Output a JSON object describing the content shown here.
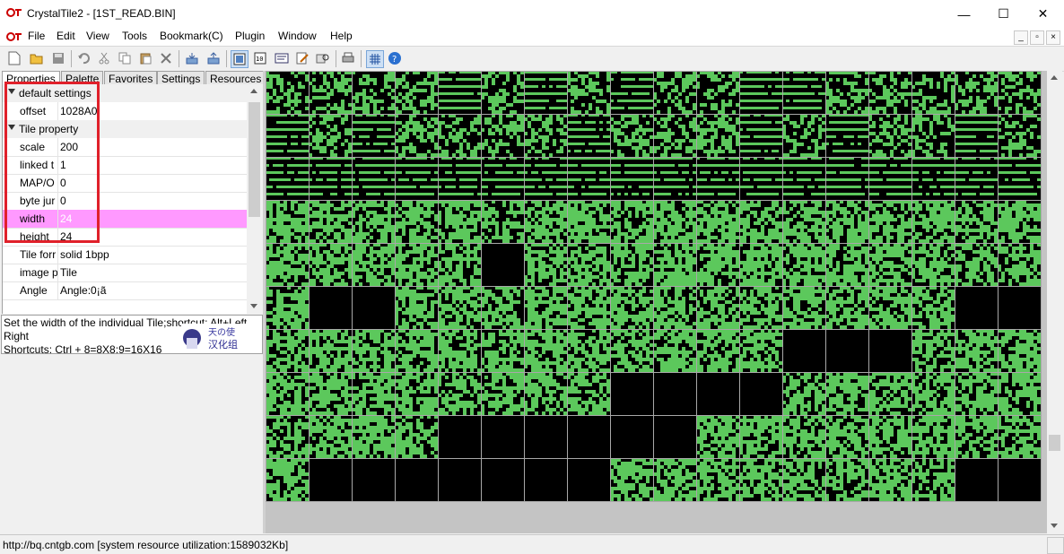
{
  "window": {
    "title": "CrystalTile2 - [1ST_READ.BIN]",
    "controls": {
      "minimize": "—",
      "maximize": "☐",
      "close": "✕"
    }
  },
  "menu": [
    "File",
    "Edit",
    "View",
    "Tools",
    "Bookmark(C)",
    "Plugin",
    "Window",
    "Help"
  ],
  "toolbar_icons": [
    "new-file-icon",
    "open-folder-icon",
    "save-icon",
    "undo-icon",
    "cut-icon",
    "copy-icon",
    "paste-icon",
    "delete-icon",
    "import-icon",
    "export-icon",
    "tile-view-icon",
    "hex-view-icon",
    "text-table-icon",
    "edit-icon",
    "search-icon",
    "print-icon",
    "grid-icon",
    "help-icon"
  ],
  "tabs": [
    "Properties",
    "Palette",
    "Favorites",
    "Settings",
    "Resources"
  ],
  "properties": {
    "cat1": "default settings",
    "offset": {
      "name": "offset",
      "value": "1028A0"
    },
    "cat2": "Tile property",
    "scale": {
      "name": "scale",
      "value": "200"
    },
    "linked": {
      "name": "linked t",
      "value": "1"
    },
    "mapo": {
      "name": "MAP/O",
      "value": "0"
    },
    "bytejump": {
      "name": "byte jur",
      "value": "0"
    },
    "width": {
      "name": "width",
      "value": "24"
    },
    "height": {
      "name": "height",
      "value": "24"
    },
    "tileformat": {
      "name": "Tile forr",
      "value": "solid 1bpp"
    },
    "image": {
      "name": "image p",
      "value": "Tile"
    },
    "angle": {
      "name": "Angle",
      "value": "Angle:0¡ã"
    }
  },
  "description": {
    "line1": "Set the width of the individual Tile;shortcut: Alt+Left,",
    "line2": "Right",
    "line3": "Shortcuts: Ctrl + 8=8X8;9=16X16",
    "logo_text": "天の使汉化组"
  },
  "status": {
    "text": "http://bq.cntgb.com [system resource utilization:1589032Kb]"
  },
  "colors": {
    "tile_green": "#5cc85c",
    "tile_black": "#000000",
    "selection": "#ff99ff",
    "annotation": "#e0202a"
  }
}
